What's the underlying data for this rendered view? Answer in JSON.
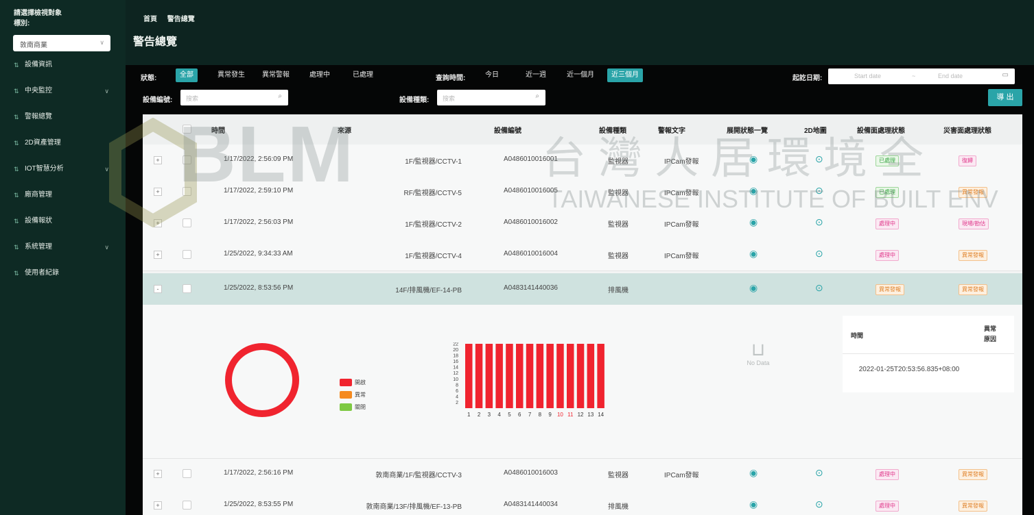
{
  "sidebar": {
    "title_line1": "請選擇檢視對象",
    "title_line2": "標別:",
    "selected_site": "敦南商業",
    "items": [
      {
        "label": "設備資訊",
        "has_arrow": false
      },
      {
        "label": "中央監控",
        "has_arrow": true
      },
      {
        "label": "警報總覽",
        "has_arrow": false
      },
      {
        "label": "2D資產管理",
        "has_arrow": false
      },
      {
        "label": "IOT智慧分析",
        "has_arrow": true
      },
      {
        "label": "廠商管理",
        "has_arrow": false
      },
      {
        "label": "設備報狀",
        "has_arrow": false
      },
      {
        "label": "系統管理",
        "has_arrow": true
      },
      {
        "label": "使用者紀錄",
        "has_arrow": false
      }
    ]
  },
  "breadcrumb": [
    "首頁",
    "警告總覽"
  ],
  "page_title": "警告總覽",
  "filters": {
    "status_label": "狀態:",
    "status_options": [
      "全部",
      "異常發生",
      "異常警報",
      "處理中",
      "已處理"
    ],
    "status_active": "全部",
    "query_time_label": "查詢時間:",
    "time_options": [
      "今日",
      "近一週",
      "近一個月",
      "近三個月"
    ],
    "time_active": "近三個月",
    "date_label": "起訖日期:",
    "start_placeholder": "Start date",
    "date_sep": "~",
    "end_placeholder": "End date",
    "device_no_label": "設備編號:",
    "device_no_placeholder": "搜索",
    "device_type_label": "設備種類:",
    "device_type_placeholder": "搜索",
    "export_label": "導 出"
  },
  "table": {
    "headers": [
      "時間",
      "來源",
      "設備編號",
      "設備種類",
      "警報文字",
      "展開狀態一覽",
      "2D地圖",
      "設備面處理狀態",
      "災害面處理狀態"
    ],
    "rows": [
      {
        "expand": "+",
        "time": "1/17/2022, 2:56:09 PM",
        "source": "1F/監視器/CCTV-1",
        "device_no": "A0486010016001",
        "type": "監視器",
        "alarm": "IPCam發報",
        "s1": "已處理",
        "s1c": "green",
        "s2": "復歸",
        "s2c": "pink"
      },
      {
        "expand": "+",
        "time": "1/17/2022, 2:59:10 PM",
        "source": "RF/監視器/CCTV-5",
        "device_no": "A0486010016005",
        "type": "監視器",
        "alarm": "IPCam發報",
        "s1": "已處理",
        "s1c": "green",
        "s2": "異常發報",
        "s2c": "orange"
      },
      {
        "expand": "+",
        "time": "1/17/2022, 2:56:03 PM",
        "source": "1F/監視器/CCTV-2",
        "device_no": "A0486010016002",
        "type": "監視器",
        "alarm": "IPCam發報",
        "s1": "處理中",
        "s1c": "pink",
        "s2": "現場/勘估",
        "s2c": "pink"
      },
      {
        "expand": "+",
        "time": "1/25/2022, 9:34:33 AM",
        "source": "1F/監視器/CCTV-4",
        "device_no": "A0486010016004",
        "type": "監視器",
        "alarm": "IPCam發報",
        "s1": "處理中",
        "s1c": "pink",
        "s2": "異常發報",
        "s2c": "orange"
      },
      {
        "expand": "-",
        "time": "1/25/2022, 8:53:56 PM",
        "source": "14F/排風機/EF-14-PB",
        "device_no": "A0483141440036",
        "type": "排風機",
        "alarm": "",
        "s1": "異常發報",
        "s1c": "orange",
        "s2": "異常發報",
        "s2c": "orange"
      },
      {
        "expand": "+",
        "time": "1/17/2022, 2:56:16 PM",
        "source": "敦南商業/1F/監視器/CCTV-3",
        "device_no": "A0486010016003",
        "type": "監視器",
        "alarm": "IPCam發報",
        "s1": "處理中",
        "s1c": "pink",
        "s2": "異常發報",
        "s2c": "orange"
      },
      {
        "expand": "+",
        "time": "1/25/2022, 8:53:55 PM",
        "source": "敦南商業/13F/排風機/EF-13-PB",
        "device_no": "A0483141440034",
        "type": "排風機",
        "alarm": "",
        "s1": "處理中",
        "s1c": "pink",
        "s2": "異常發報",
        "s2c": "orange"
      }
    ]
  },
  "expanded": {
    "legend": [
      {
        "label": "開啟",
        "color": "#f0242f"
      },
      {
        "label": "異常",
        "color": "#f58a1f"
      },
      {
        "label": "關閉",
        "color": "#7ec942"
      }
    ],
    "no_data": "No Data",
    "detail_header_time": "時間",
    "detail_header_reason": "異常原因",
    "detail_value": "2022-01-25T20:53:56.835+08:00"
  },
  "chart_data": {
    "type": "bar",
    "categories": [
      "1",
      "2",
      "3",
      "4",
      "5",
      "6",
      "7",
      "8",
      "9",
      "10",
      "11",
      "12",
      "13",
      "14"
    ],
    "highlight_categories": [
      "10",
      "11"
    ],
    "values": [
      22,
      22,
      22,
      22,
      22,
      22,
      22,
      22,
      22,
      22,
      22,
      22,
      22,
      22
    ],
    "ylim": [
      0,
      22
    ],
    "y_ticks": [
      2,
      4,
      6,
      8,
      10,
      12,
      14,
      16,
      18,
      20,
      22
    ],
    "color": "#f0242f",
    "highlight_color": "#f0242f"
  },
  "watermark": {
    "brand": "BLM",
    "cn": "台灣人居環境全",
    "en": "TAIWANESE INSTITUTE OF BUILT ENV"
  },
  "colors": {
    "accent": "#2aa4a8",
    "sidebar_bg": "#0e2a24",
    "selected_row": "#cfe2df"
  }
}
